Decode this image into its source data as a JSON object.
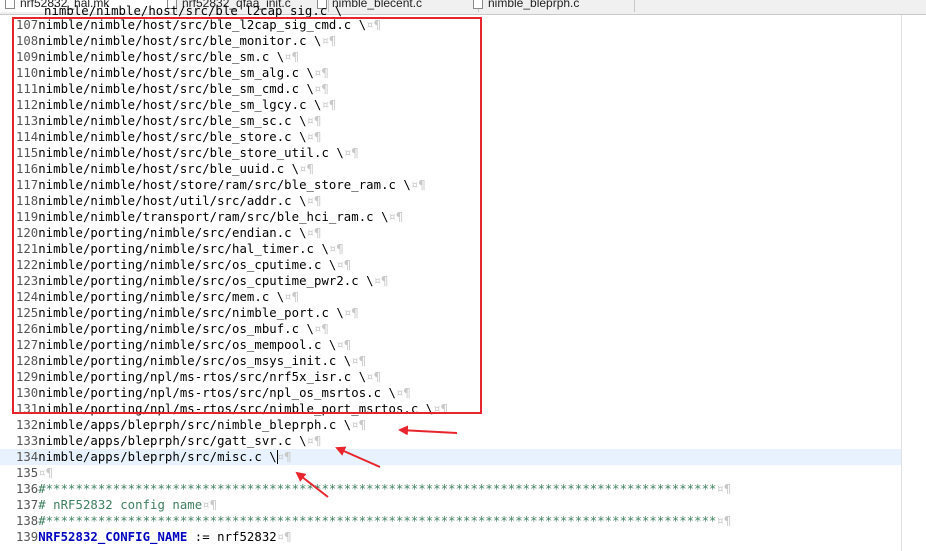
{
  "tabs": [
    {
      "label": "nrf52832_hal.mk",
      "active": true
    },
    {
      "label": "nrf52832_qfaa_init.c",
      "active": false
    },
    {
      "label": "nimble_blecent.c",
      "active": false
    },
    {
      "label": "nimble_bleprph.c",
      "active": false
    }
  ],
  "partial_top_line": "nimble/nimble/host/src/ble_l2cap_sig.c \\",
  "whitespace_marker": "¤¶",
  "lines": [
    {
      "n": "107",
      "text": "nimble/nimble/host/src/ble_l2cap_sig_cmd.c \\"
    },
    {
      "n": "108",
      "text": "nimble/nimble/host/src/ble_monitor.c \\"
    },
    {
      "n": "109",
      "text": "nimble/nimble/host/src/ble_sm.c \\"
    },
    {
      "n": "110",
      "text": "nimble/nimble/host/src/ble_sm_alg.c \\"
    },
    {
      "n": "111",
      "text": "nimble/nimble/host/src/ble_sm_cmd.c \\"
    },
    {
      "n": "112",
      "text": "nimble/nimble/host/src/ble_sm_lgcy.c \\"
    },
    {
      "n": "113",
      "text": "nimble/nimble/host/src/ble_sm_sc.c \\"
    },
    {
      "n": "114",
      "text": "nimble/nimble/host/src/ble_store.c \\"
    },
    {
      "n": "115",
      "text": "nimble/nimble/host/src/ble_store_util.c \\"
    },
    {
      "n": "116",
      "text": "nimble/nimble/host/src/ble_uuid.c \\"
    },
    {
      "n": "117",
      "text": "nimble/nimble/host/store/ram/src/ble_store_ram.c \\"
    },
    {
      "n": "118",
      "text": "nimble/nimble/host/util/src/addr.c \\"
    },
    {
      "n": "119",
      "text": "nimble/nimble/transport/ram/src/ble_hci_ram.c \\"
    },
    {
      "n": "120",
      "text": "nimble/porting/nimble/src/endian.c \\"
    },
    {
      "n": "121",
      "text": "nimble/porting/nimble/src/hal_timer.c \\"
    },
    {
      "n": "122",
      "text": "nimble/porting/nimble/src/os_cputime.c \\"
    },
    {
      "n": "123",
      "text": "nimble/porting/nimble/src/os_cputime_pwr2.c \\"
    },
    {
      "n": "124",
      "text": "nimble/porting/nimble/src/mem.c \\"
    },
    {
      "n": "125",
      "text": "nimble/porting/nimble/src/nimble_port.c \\"
    },
    {
      "n": "126",
      "text": "nimble/porting/nimble/src/os_mbuf.c \\"
    },
    {
      "n": "127",
      "text": "nimble/porting/nimble/src/os_mempool.c \\"
    },
    {
      "n": "128",
      "text": "nimble/porting/nimble/src/os_msys_init.c \\"
    },
    {
      "n": "129",
      "text": "nimble/porting/npl/ms-rtos/src/nrf5x_isr.c \\"
    },
    {
      "n": "130",
      "text": "nimble/porting/npl/ms-rtos/src/npl_os_msrtos.c \\"
    },
    {
      "n": "131",
      "text": "nimble/porting/npl/ms-rtos/src/nimble_port_msrtos.c \\"
    },
    {
      "n": "132",
      "text": "nimble/apps/bleprph/src/nimble_bleprph.c \\"
    },
    {
      "n": "133",
      "text": "nimble/apps/bleprph/src/gatt_svr.c \\"
    },
    {
      "n": "134",
      "text": "nimble/apps/bleprph/src/misc.c \\"
    },
    {
      "n": "135",
      "text": ""
    },
    {
      "n": "136",
      "text": "#******************************************************************************************",
      "kind": "comment"
    },
    {
      "n": "137",
      "text": "# nRF52832 config name",
      "kind": "comment"
    },
    {
      "n": "138",
      "text": "#******************************************************************************************",
      "kind": "comment"
    },
    {
      "n": "139",
      "text": " := nrf52832",
      "kind": "var",
      "var_name": "NRF52832_CONFIG_NAME"
    }
  ],
  "colors": {
    "highlight_box": "#e8252d",
    "arrow": "#e8252d",
    "comment": "#3f7f5f",
    "variable": "#0000c0",
    "current_line": "#e8f2fe"
  }
}
